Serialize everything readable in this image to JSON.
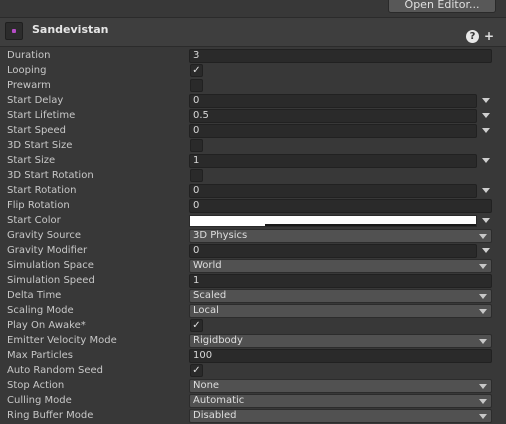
{
  "toolbar": {
    "open_editor_label": "Open Editor..."
  },
  "module": {
    "title": "Sandevistan",
    "help_glyph": "?",
    "add_glyph": "+"
  },
  "properties": {
    "duration": {
      "label": "Duration",
      "value": "3"
    },
    "looping": {
      "label": "Looping",
      "checked": true
    },
    "prewarm": {
      "label": "Prewarm",
      "checked": false
    },
    "start_delay": {
      "label": "Start Delay",
      "value": "0"
    },
    "start_lifetime": {
      "label": "Start Lifetime",
      "value": "0.5"
    },
    "start_speed": {
      "label": "Start Speed",
      "value": "0"
    },
    "start_size_3d": {
      "label": "3D Start Size",
      "checked": false
    },
    "start_size": {
      "label": "Start Size",
      "value": "1"
    },
    "start_rotation_3d": {
      "label": "3D Start Rotation",
      "checked": false
    },
    "start_rotation": {
      "label": "Start Rotation",
      "value": "0"
    },
    "flip_rotation": {
      "label": "Flip Rotation",
      "value": "0"
    },
    "start_color": {
      "label": "Start Color",
      "color": "#ffffff"
    },
    "gravity_source": {
      "label": "Gravity Source",
      "value": "3D Physics"
    },
    "gravity_modifier": {
      "label": "Gravity Modifier",
      "value": "0"
    },
    "simulation_space": {
      "label": "Simulation Space",
      "value": "World"
    },
    "simulation_speed": {
      "label": "Simulation Speed",
      "value": "1"
    },
    "delta_time": {
      "label": "Delta Time",
      "value": "Scaled"
    },
    "scaling_mode": {
      "label": "Scaling Mode",
      "value": "Local"
    },
    "play_on_awake": {
      "label": "Play On Awake*",
      "checked": true
    },
    "emitter_velocity_mode": {
      "label": "Emitter Velocity Mode",
      "value": "Rigidbody"
    },
    "max_particles": {
      "label": "Max Particles",
      "value": "100"
    },
    "auto_random_seed": {
      "label": "Auto Random Seed",
      "checked": true
    },
    "stop_action": {
      "label": "Stop Action",
      "value": "None"
    },
    "culling_mode": {
      "label": "Culling Mode",
      "value": "Automatic"
    },
    "ring_buffer_mode": {
      "label": "Ring Buffer Mode",
      "value": "Disabled"
    }
  },
  "glyphs": {
    "check": "✓"
  },
  "colors": {
    "background": "#383838",
    "field": "#2a2a2a",
    "dropdown": "#515151",
    "accent_icon": "#b54cc6"
  }
}
